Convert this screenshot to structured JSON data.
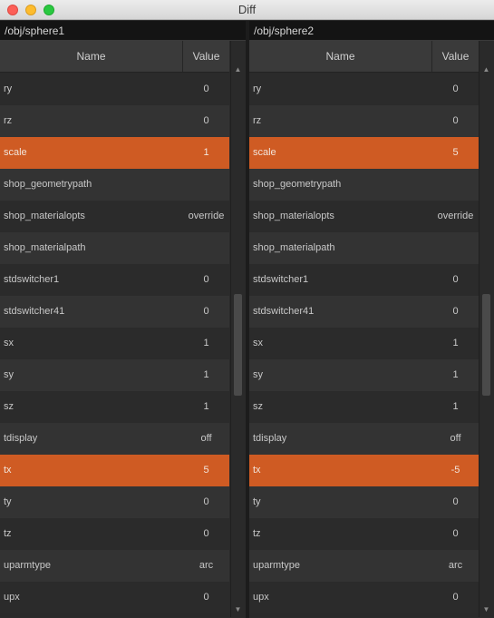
{
  "window": {
    "title": "Diff"
  },
  "left": {
    "path": "/obj/sphere1",
    "col_name": "Name",
    "col_value": "Value",
    "rows": [
      {
        "name": "ry",
        "value": "0",
        "diff": false
      },
      {
        "name": "rz",
        "value": "0",
        "diff": false
      },
      {
        "name": "scale",
        "value": "1",
        "diff": true
      },
      {
        "name": "shop_geometrypath",
        "value": "",
        "diff": false
      },
      {
        "name": "shop_materialopts",
        "value": "override",
        "diff": false
      },
      {
        "name": "shop_materialpath",
        "value": "",
        "diff": false
      },
      {
        "name": "stdswitcher1",
        "value": "0",
        "diff": false
      },
      {
        "name": "stdswitcher41",
        "value": "0",
        "diff": false
      },
      {
        "name": "sx",
        "value": "1",
        "diff": false
      },
      {
        "name": "sy",
        "value": "1",
        "diff": false
      },
      {
        "name": "sz",
        "value": "1",
        "diff": false
      },
      {
        "name": "tdisplay",
        "value": "off",
        "diff": false
      },
      {
        "name": "tx",
        "value": "5",
        "diff": true
      },
      {
        "name": "ty",
        "value": "0",
        "diff": false
      },
      {
        "name": "tz",
        "value": "0",
        "diff": false
      },
      {
        "name": "uparmtype",
        "value": "arc",
        "diff": false
      },
      {
        "name": "upx",
        "value": "0",
        "diff": false
      }
    ]
  },
  "right": {
    "path": "/obj/sphere2",
    "col_name": "Name",
    "col_value": "Value",
    "rows": [
      {
        "name": "ry",
        "value": "0",
        "diff": false
      },
      {
        "name": "rz",
        "value": "0",
        "diff": false
      },
      {
        "name": "scale",
        "value": "5",
        "diff": true
      },
      {
        "name": "shop_geometrypath",
        "value": "",
        "diff": false
      },
      {
        "name": "shop_materialopts",
        "value": "override",
        "diff": false
      },
      {
        "name": "shop_materialpath",
        "value": "",
        "diff": false
      },
      {
        "name": "stdswitcher1",
        "value": "0",
        "diff": false
      },
      {
        "name": "stdswitcher41",
        "value": "0",
        "diff": false
      },
      {
        "name": "sx",
        "value": "1",
        "diff": false
      },
      {
        "name": "sy",
        "value": "1",
        "diff": false
      },
      {
        "name": "sz",
        "value": "1",
        "diff": false
      },
      {
        "name": "tdisplay",
        "value": "off",
        "diff": false
      },
      {
        "name": "tx",
        "value": "-5",
        "diff": true
      },
      {
        "name": "ty",
        "value": "0",
        "diff": false
      },
      {
        "name": "tz",
        "value": "0",
        "diff": false
      },
      {
        "name": "uparmtype",
        "value": "arc",
        "diff": false
      },
      {
        "name": "upx",
        "value": "0",
        "diff": false
      }
    ]
  },
  "colors": {
    "diff_highlight": "#cf5b23",
    "row_dark": "#2b2b2b",
    "row_light": "#333333",
    "header": "#3a3a3a"
  },
  "icons": {
    "scroll_up": "triangle-up",
    "scroll_down": "triangle-down"
  }
}
